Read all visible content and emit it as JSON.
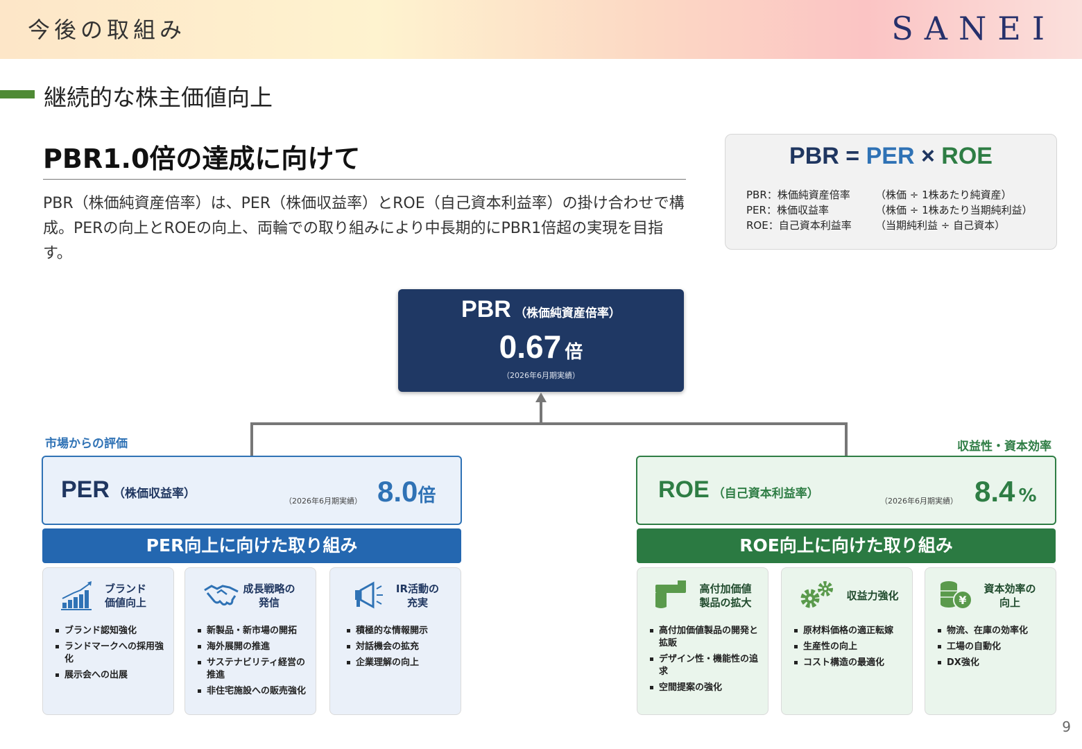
{
  "header": {
    "title": "今後の取組み",
    "logo": "SANEI"
  },
  "section": {
    "title": "継続的な株主価値向上"
  },
  "main": {
    "heading": "PBR1.0倍の達成に向けて",
    "lead": "PBR（株価純資産倍率）は、PER（株価収益率）とROE（自己資本利益率）の掛け合わせで構成。PERの向上とROEの向上、両輪での取り組みにより中長期的にPBR1倍超の実現を目指す。"
  },
  "formula": {
    "pbr": "PBR",
    "eq": "=",
    "per": "PER",
    "times": "×",
    "roe": "ROE",
    "definitions": [
      {
        "term": "PBR：株価純資産倍率",
        "desc": "（株価 ÷ 1株あたり純資産）"
      },
      {
        "term": "PER：株価収益率",
        "desc": "（株価 ÷ 1株あたり当期純利益）"
      },
      {
        "term": "ROE：自己資本利益率",
        "desc": "（当期純利益 ÷ 自己資本）"
      }
    ]
  },
  "pbr_box": {
    "name": "PBR",
    "name_sub": "（株価純資産倍率）",
    "value": "0.67",
    "unit": "倍",
    "note": "（2026年6月期実績）"
  },
  "labels": {
    "left": "市場からの評価",
    "right": "収益性・資本効率"
  },
  "per_box": {
    "name": "PER",
    "name_sub": "（株価収益率）",
    "note": "（2026年6月期実績）",
    "value": "8.0",
    "unit": "倍"
  },
  "roe_box": {
    "name": "ROE",
    "name_sub": "（自己資本利益率）",
    "note": "（2026年6月期実績）",
    "value": "8.4",
    "unit": "%"
  },
  "banners": {
    "per": "PER向上に向けた取り組み",
    "roe": "ROE向上に向けた取り組み"
  },
  "colors": {
    "navy": "#1f3864",
    "blue": "#2467b0",
    "green": "#2b7a42",
    "accent_bar": "#4e8a34"
  },
  "cards": [
    {
      "icon": "bar-chart-icon",
      "title": "ブランド\n価値向上",
      "items": [
        "ブランド認知強化",
        "ランドマークへの採用強化",
        "展示会への出展"
      ]
    },
    {
      "icon": "handshake-icon",
      "title": "成長戦略の\n発信",
      "items": [
        "新製品・新市場の開拓",
        "海外展開の推進",
        "サステナビリティ経営の推進",
        "非住宅施設への販売強化"
      ]
    },
    {
      "icon": "megaphone-icon",
      "title": "IR活動の\n充実",
      "items": [
        "積極的な情報開示",
        "対話機会の拡充",
        "企業理解の向上"
      ]
    },
    {
      "icon": "faucet-icon",
      "title": "高付加価値\n製品の拡大",
      "items": [
        "高付加価値製品の開発と拡販",
        "デザイン性・機能性の追求",
        "空間提案の強化"
      ]
    },
    {
      "icon": "gears-icon",
      "title": "収益力強化",
      "items": [
        "原材料価格の適正転嫁",
        "生産性の向上",
        "コスト構造の最適化"
      ]
    },
    {
      "icon": "coins-yen-icon",
      "title": "資本効率の\n向上",
      "items": [
        "物流、在庫の効率化",
        "工場の自動化",
        "DX強化"
      ]
    }
  ],
  "page_number": "9"
}
